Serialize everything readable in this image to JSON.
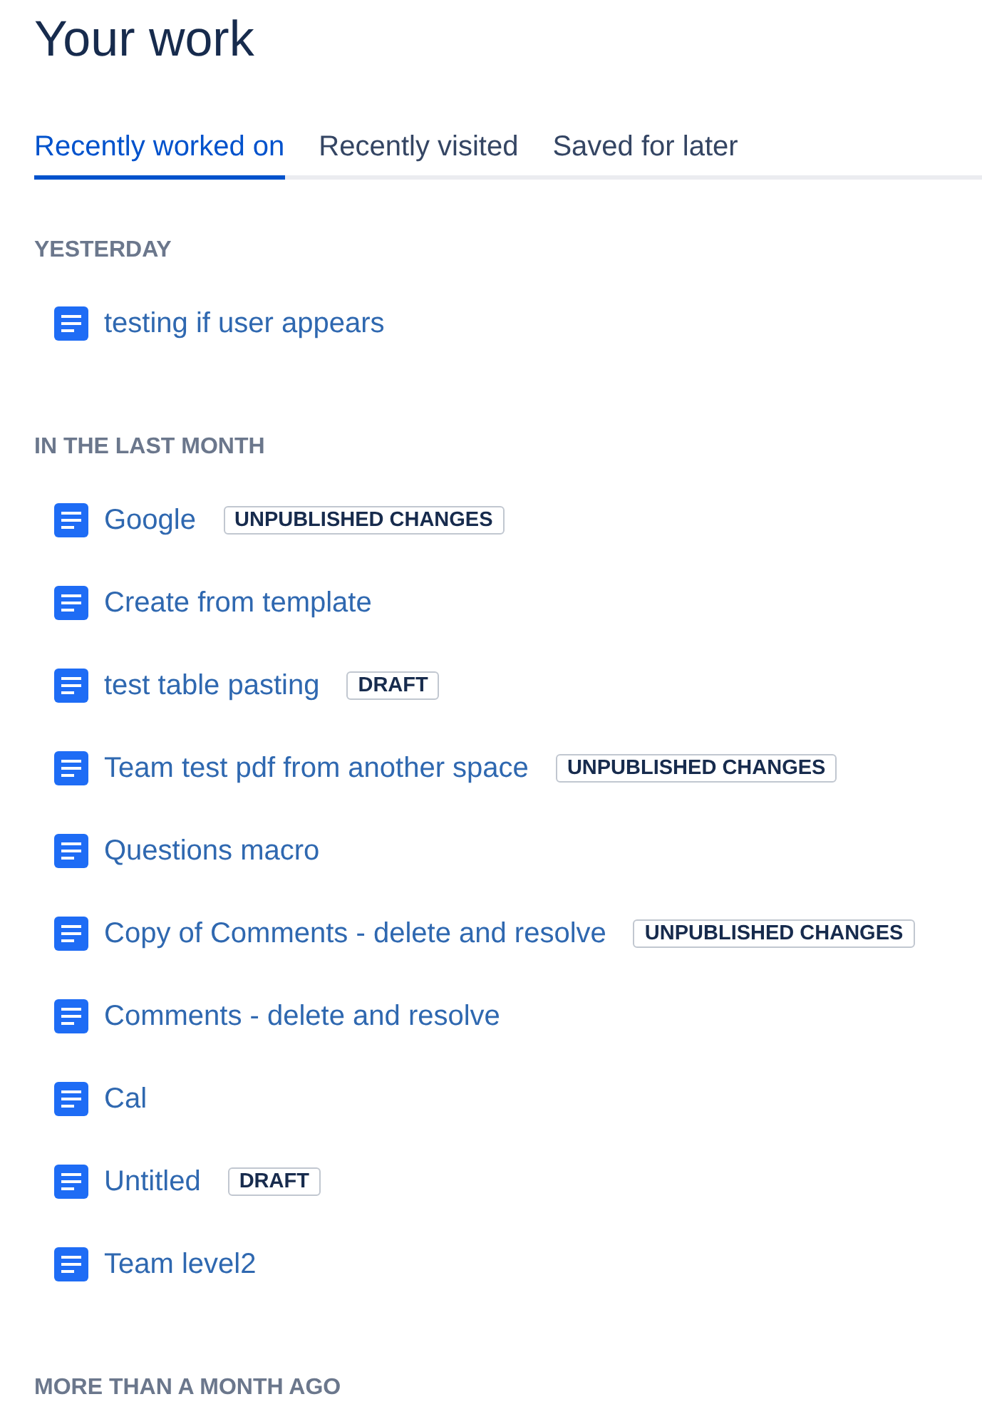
{
  "title": "Your work",
  "tabs": [
    {
      "label": "Recently worked on",
      "selected": true
    },
    {
      "label": "Recently visited",
      "selected": false
    },
    {
      "label": "Saved for later",
      "selected": false
    }
  ],
  "sections": [
    {
      "heading": "YESTERDAY",
      "items": [
        {
          "title": "testing if user appears"
        }
      ]
    },
    {
      "heading": "IN THE LAST MONTH",
      "items": [
        {
          "title": "Google",
          "badge": "UNPUBLISHED CHANGES"
        },
        {
          "title": "Create from template"
        },
        {
          "title": "test table pasting",
          "badge": "DRAFT"
        },
        {
          "title": "Team test pdf from another space",
          "badge": "UNPUBLISHED CHANGES"
        },
        {
          "title": "Questions macro"
        },
        {
          "title": "Copy of Comments - delete and resolve",
          "badge": "UNPUBLISHED CHANGES"
        },
        {
          "title": "Comments - delete and resolve"
        },
        {
          "title": "Cal"
        },
        {
          "title": "Untitled",
          "badge": "DRAFT"
        },
        {
          "title": "Team level2"
        }
      ]
    },
    {
      "heading": "MORE THAN A MONTH AGO"
    }
  ]
}
